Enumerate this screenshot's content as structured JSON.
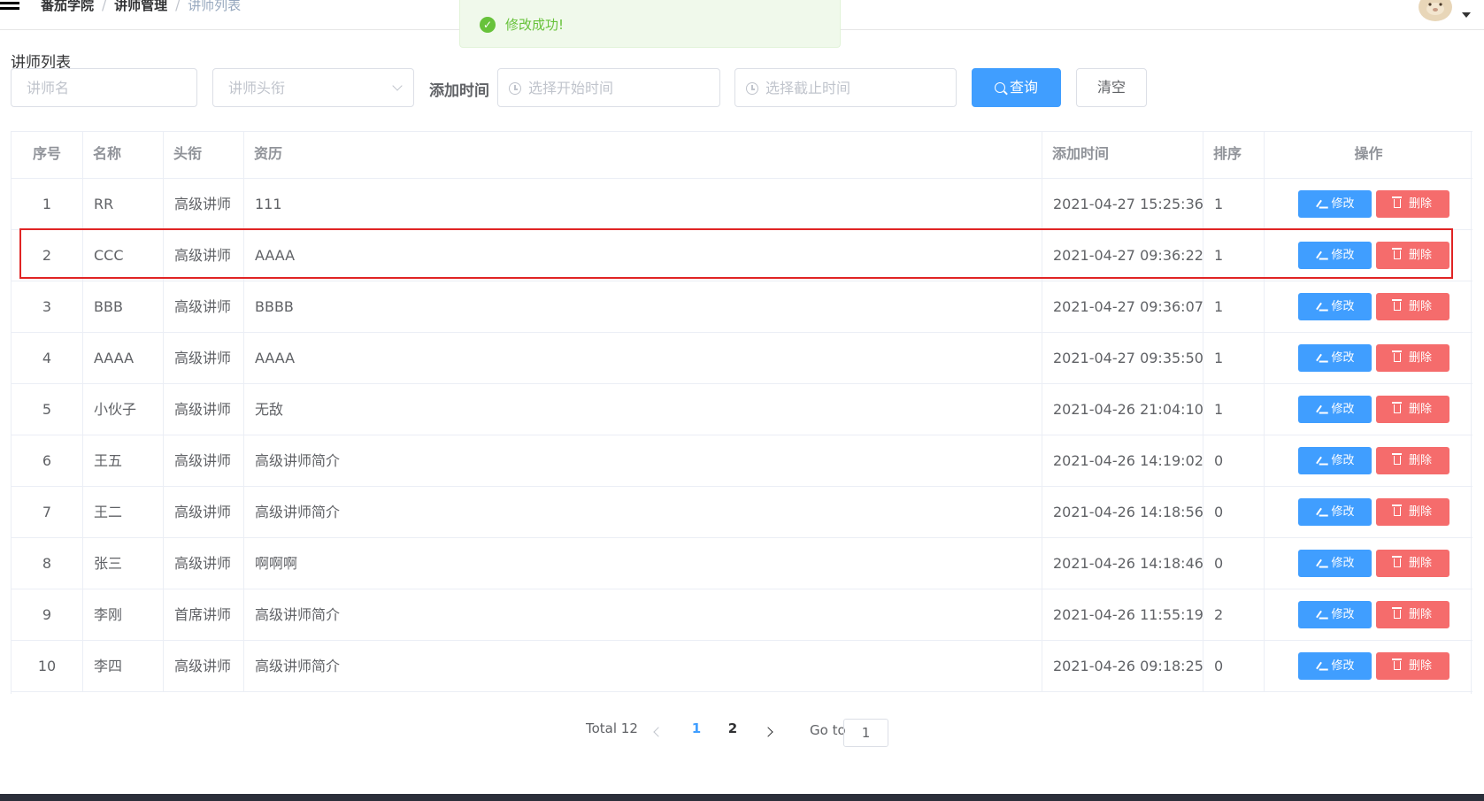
{
  "navbar": {
    "breadcrumb": [
      "番茄学院",
      "讲师管理",
      "讲师列表"
    ],
    "separator": "/"
  },
  "message": {
    "text": "修改成功!"
  },
  "page_title": "讲师列表",
  "filters": {
    "name_placeholder": "讲师名",
    "level_placeholder": "讲师头衔",
    "date_label": "添加时间",
    "start_placeholder": "选择开始时间",
    "end_placeholder": "选择截止时间",
    "search_label": "查询",
    "clear_label": "清空"
  },
  "table": {
    "headers": {
      "index": "序号",
      "name": "名称",
      "level": "头衔",
      "intro": "资历",
      "created": "添加时间",
      "sort": "排序",
      "ops": "操作"
    },
    "edit_label": "修改",
    "delete_label": "删除",
    "rows": [
      {
        "index": "1",
        "name": "RR",
        "level": "高级讲师",
        "intro": "111",
        "created": "2021-04-27 15:25:36",
        "sort": "1"
      },
      {
        "index": "2",
        "name": "CCC",
        "level": "高级讲师",
        "intro": "AAAA",
        "created": "2021-04-27 09:36:22",
        "sort": "1"
      },
      {
        "index": "3",
        "name": "BBB",
        "level": "高级讲师",
        "intro": "BBBB",
        "created": "2021-04-27 09:36:07",
        "sort": "1"
      },
      {
        "index": "4",
        "name": "AAAA",
        "level": "高级讲师",
        "intro": "AAAA",
        "created": "2021-04-27 09:35:50",
        "sort": "1"
      },
      {
        "index": "5",
        "name": "小伙子",
        "level": "高级讲师",
        "intro": "无敌",
        "created": "2021-04-26 21:04:10",
        "sort": "1"
      },
      {
        "index": "6",
        "name": "王五",
        "level": "高级讲师",
        "intro": "高级讲师简介",
        "created": "2021-04-26 14:19:02",
        "sort": "0"
      },
      {
        "index": "7",
        "name": "王二",
        "level": "高级讲师",
        "intro": "高级讲师简介",
        "created": "2021-04-26 14:18:56",
        "sort": "0"
      },
      {
        "index": "8",
        "name": "张三",
        "level": "高级讲师",
        "intro": "啊啊啊",
        "created": "2021-04-26 14:18:46",
        "sort": "0"
      },
      {
        "index": "9",
        "name": "李刚",
        "level": "首席讲师",
        "intro": "高级讲师简介",
        "created": "2021-04-26 11:55:19",
        "sort": "2"
      },
      {
        "index": "10",
        "name": "李四",
        "level": "高级讲师",
        "intro": "高级讲师简介",
        "created": "2021-04-26 09:18:25",
        "sort": "0"
      }
    ]
  },
  "pagination": {
    "total_text": "Total 12",
    "pages": [
      "1",
      "2"
    ],
    "current_page": "1",
    "goto_label": "Go to",
    "goto_value": "1"
  },
  "colors": {
    "primary": "#409eff",
    "danger": "#f56c6c",
    "success": "#67c23a",
    "highlight": "#e02424"
  }
}
